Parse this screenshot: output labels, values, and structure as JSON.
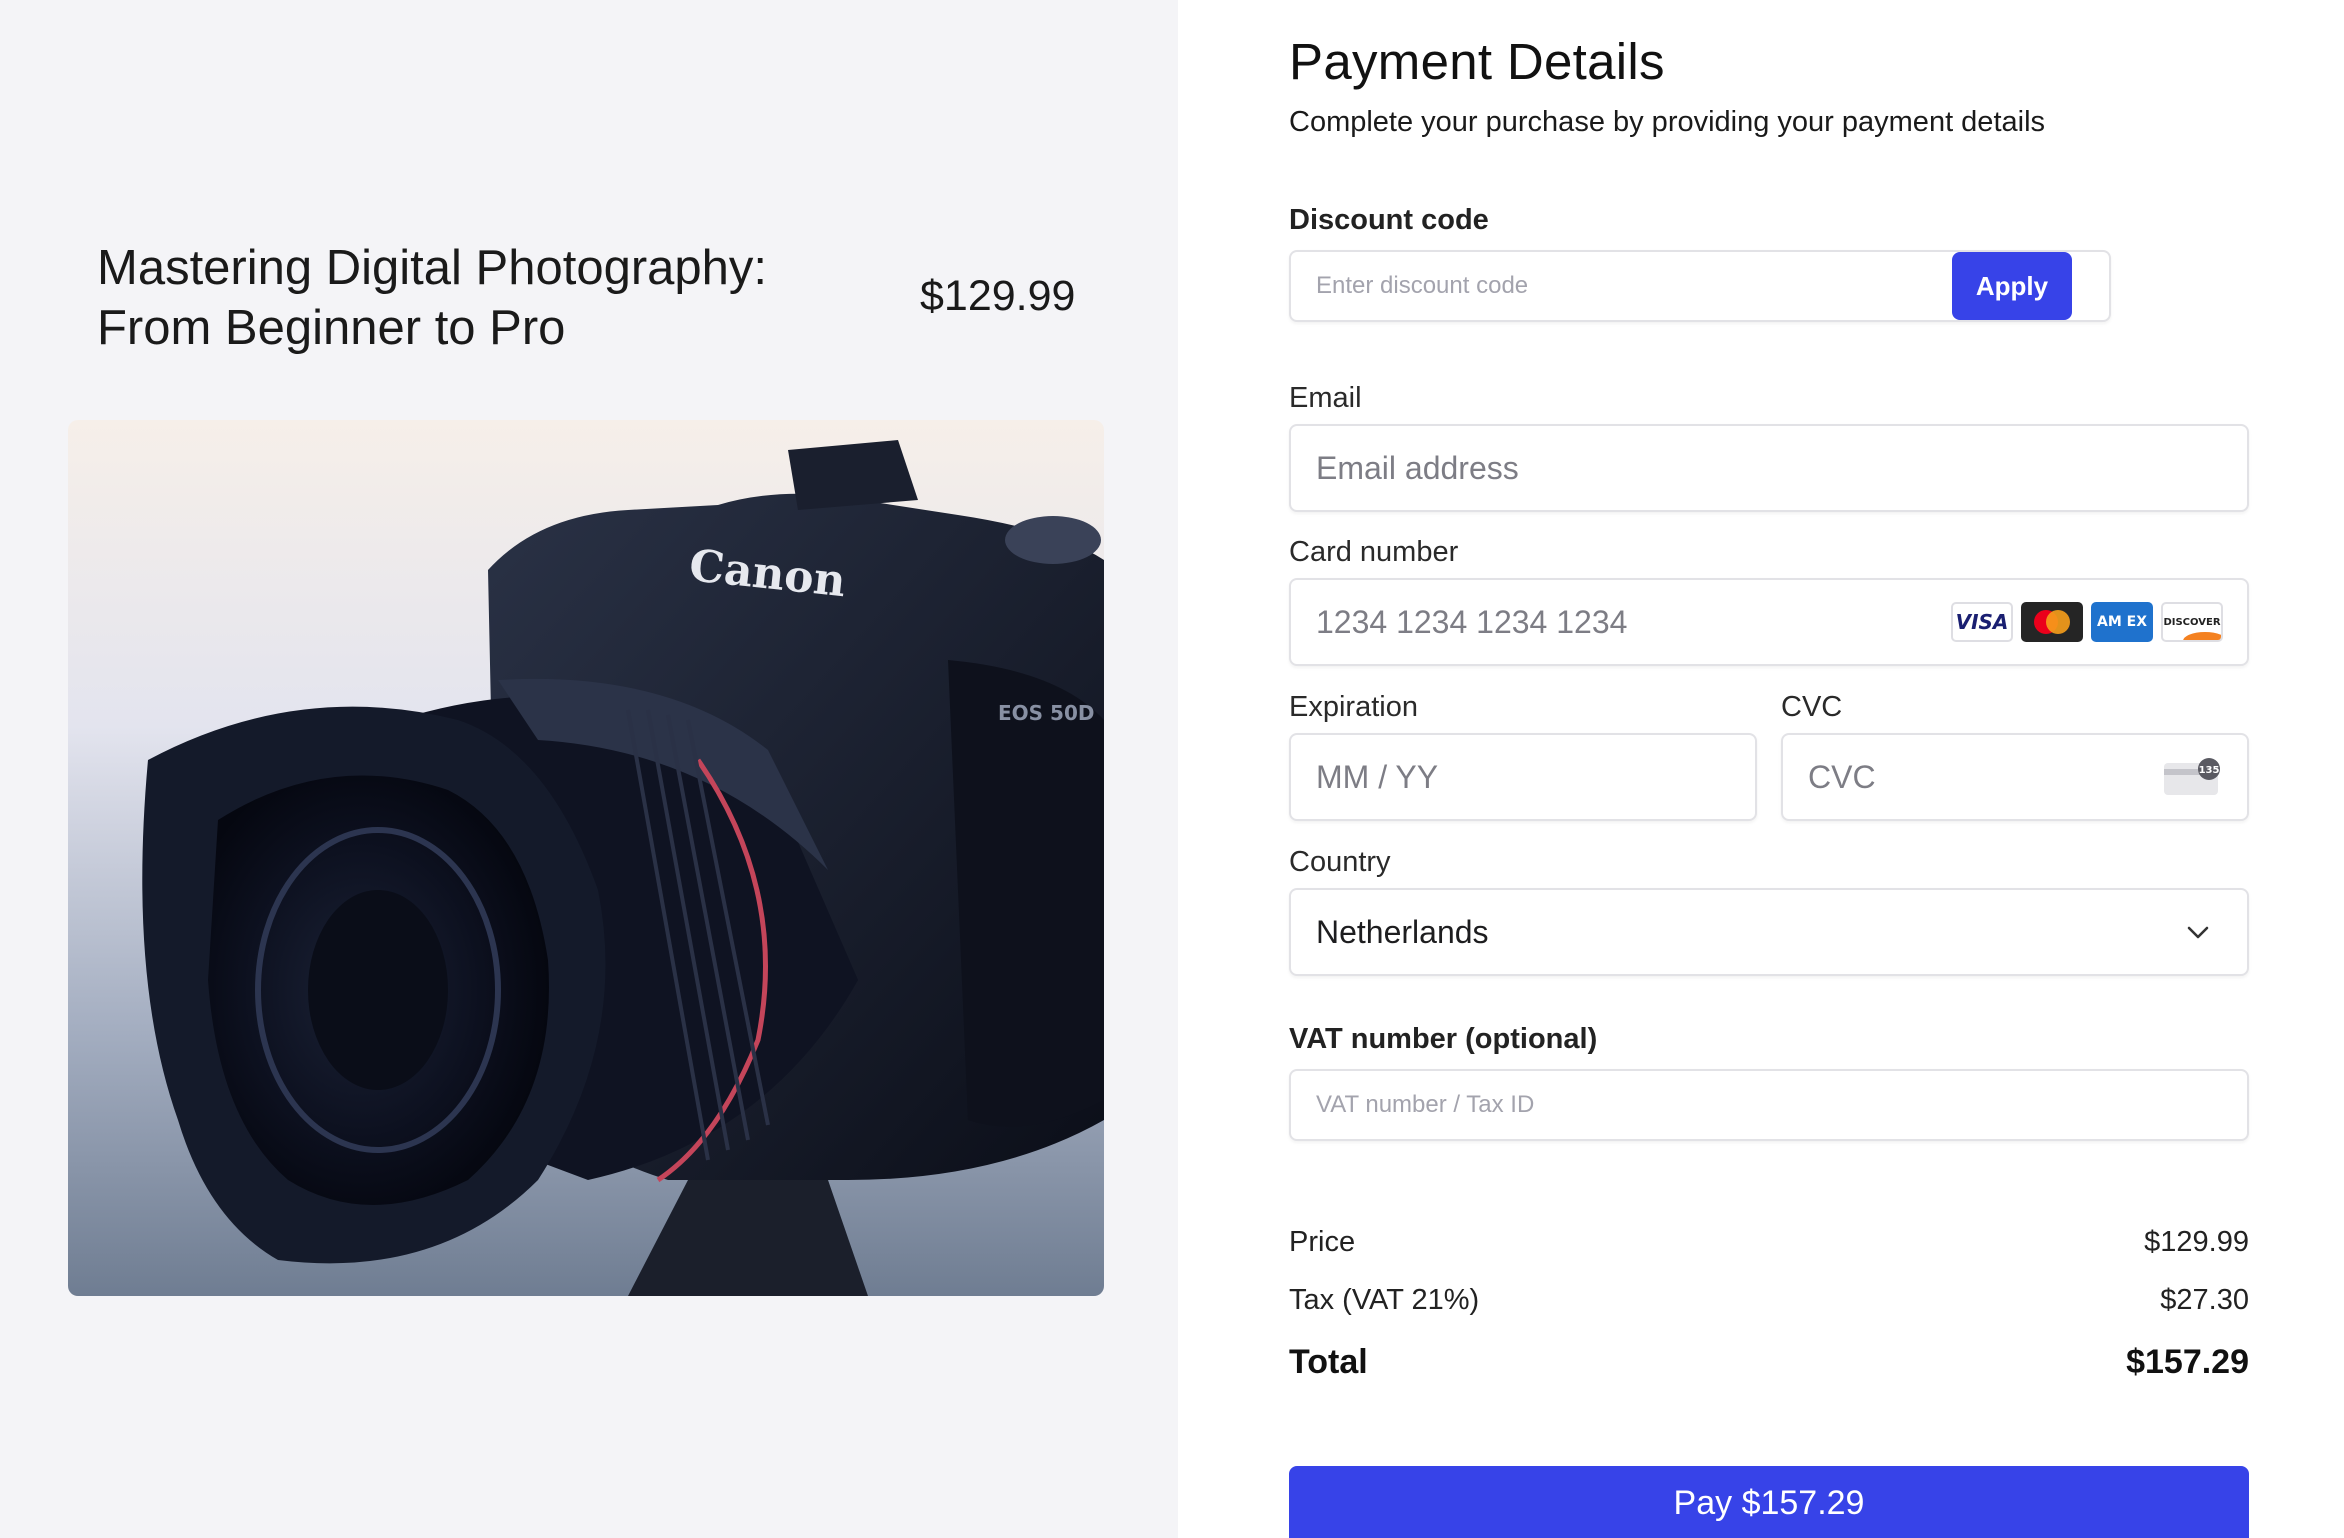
{
  "product": {
    "title": "Mastering Digital Photography: From Beginner to Pro",
    "price": "$129.99",
    "image_label": "Canon",
    "image_model": "EOS 50D"
  },
  "payment": {
    "heading": "Payment Details",
    "subheading": "Complete your purchase by providing your payment details",
    "discount": {
      "label": "Discount code",
      "placeholder": "Enter discount code",
      "apply_label": "Apply"
    },
    "email": {
      "label": "Email",
      "placeholder": "Email address"
    },
    "card": {
      "label": "Card number",
      "placeholder": "1234 1234 1234 1234",
      "brands": {
        "visa": "VISA",
        "amex": "AM EX",
        "discover": "DISCOVER"
      },
      "brand_icons": [
        "visa-icon",
        "mastercard-icon",
        "amex-icon",
        "discover-icon"
      ]
    },
    "expiration": {
      "label": "Expiration",
      "placeholder": "MM / YY"
    },
    "cvc": {
      "label": "CVC",
      "placeholder": "CVC",
      "icon_text": "135"
    },
    "country": {
      "label": "Country",
      "selected": "Netherlands"
    },
    "vat": {
      "label": "VAT number (optional)",
      "placeholder": "VAT number / Tax ID"
    }
  },
  "summary": {
    "price_label": "Price",
    "price_value": "$129.99",
    "tax_label": "Tax (VAT 21%)",
    "tax_value": "$27.30",
    "total_label": "Total",
    "total_value": "$157.29"
  },
  "pay_button": "Pay $157.29",
  "colors": {
    "accent": "#3743e8",
    "left_background": "#f4f4f7",
    "right_background": "#ffffff"
  }
}
